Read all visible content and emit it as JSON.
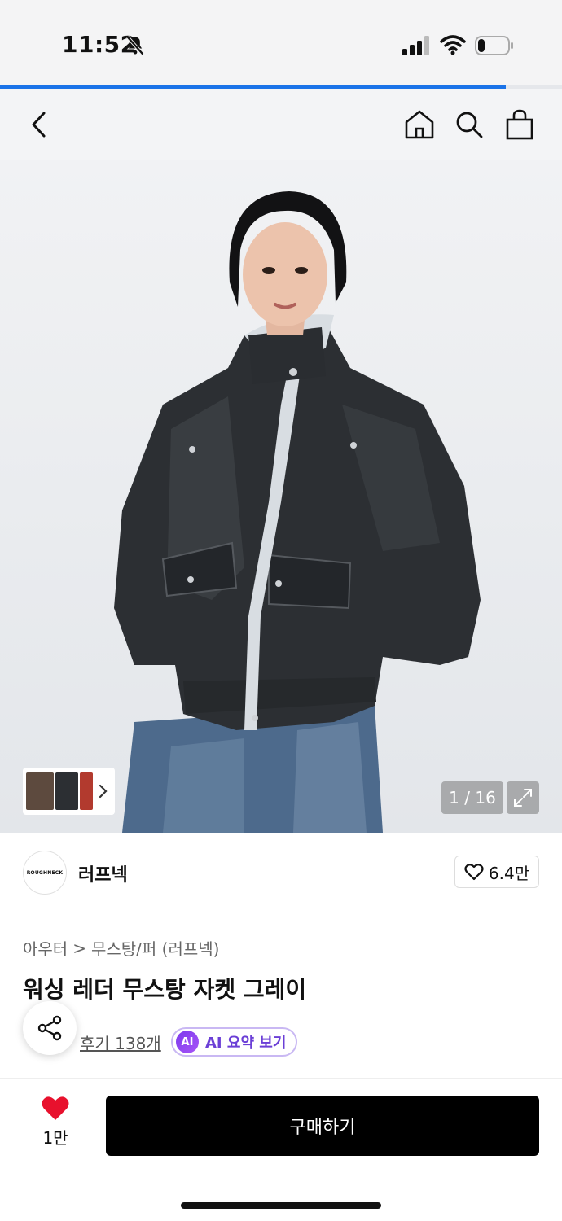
{
  "status": {
    "time": "11:52"
  },
  "page_progress": 0.9,
  "product": {
    "image_counter": "1 / 16",
    "brand": {
      "logo_text": "ROUGHNECK",
      "name": "러프넥"
    },
    "likes": "6.4만",
    "breadcrumb": {
      "category": "아우터",
      "separator": ">",
      "subcategory": "무스탕/퍼 (러프넥)"
    },
    "title": "워싱 레더 무스탕 자켓 그레이",
    "reviews": "후기 138개",
    "ai_summary": {
      "badge": "AI",
      "label": "AI 요약 보기"
    }
  },
  "bottom_bar": {
    "wish_count": "1만",
    "buy_label": "구매하기"
  },
  "colors": {
    "accent": "#1a73e8",
    "heart": "#e8112d",
    "buy": "#000000",
    "ai": "#7c3aed"
  }
}
